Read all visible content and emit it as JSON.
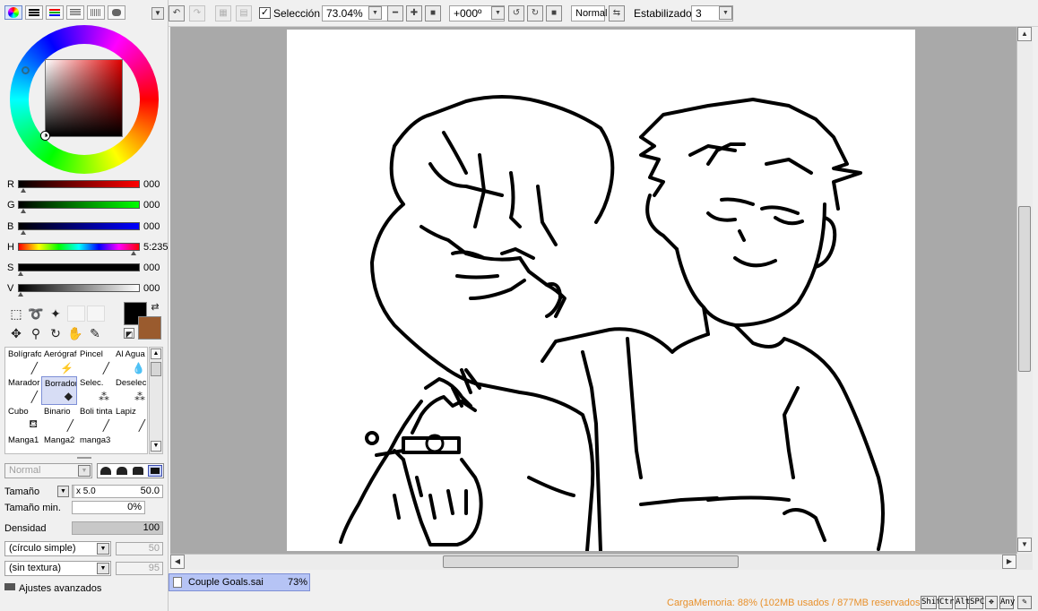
{
  "app": {
    "document_name": "Couple Goals.sai",
    "document_zoom": "73%"
  },
  "color_panel": {
    "sliders": [
      {
        "label": "R",
        "value": "000",
        "color": "#ff0000"
      },
      {
        "label": "G",
        "value": "000",
        "color": "#00ff00"
      },
      {
        "label": "B",
        "value": "000",
        "color": "#0000ff"
      },
      {
        "label": "H",
        "value": "5:235",
        "color": "hue"
      },
      {
        "label": "S",
        "value": "000",
        "color": "#000000"
      },
      {
        "label": "V",
        "value": "000",
        "color": "#ffffff"
      }
    ],
    "foreground_color": "#000000",
    "background_color": "#9a5b2e"
  },
  "brush_tools": [
    {
      "label": "Bolígrafo",
      "icon": "pen-icon"
    },
    {
      "label": "Aerógrafo",
      "icon": "airbrush-icon"
    },
    {
      "label": "Pincel",
      "icon": "brush-icon"
    },
    {
      "label": "Al Agua",
      "icon": "water-icon"
    },
    {
      "label": "Marador",
      "icon": "marker-icon"
    },
    {
      "label": "Borrador",
      "icon": "eraser-icon"
    },
    {
      "label": "Selec.",
      "icon": "select-pen-icon"
    },
    {
      "label": "Deselec.",
      "icon": "deselect-pen-icon"
    },
    {
      "label": "Cubo",
      "icon": "bucket-icon"
    },
    {
      "label": "Binario",
      "icon": "binary-pen-icon"
    },
    {
      "label": "Boli tinta",
      "icon": "ink-pen-icon"
    },
    {
      "label": "Lapiz",
      "icon": "pencil-icon"
    },
    {
      "label": "Manga1",
      "icon": "manga-pen-icon"
    },
    {
      "label": "Manga2",
      "icon": "manga-pen-icon"
    },
    {
      "label": "manga3",
      "icon": "manga-pen-icon"
    }
  ],
  "brush_settings": {
    "blend_mode": "Normal",
    "size_label": "Tamaño",
    "size_multiplier": "x 5.0",
    "size_value": "50.0",
    "min_size_label": "Tamaño min.",
    "min_size_value": "0%",
    "density_label": "Densidad",
    "density_value": "100",
    "shape": "(círculo simple)",
    "shape_value": "50",
    "texture": "(sin textura)",
    "texture_value": "95",
    "advanced_label": "Ajustes avanzados"
  },
  "toolbar": {
    "selection_label": "Selección",
    "selection_checked": true,
    "zoom": "73.04%",
    "rotation": "+000º",
    "view_mode": "Normal",
    "stabilizer_label": "Estabilizador",
    "stabilizer_value": "3"
  },
  "status": {
    "memory_text": "CargaMemoria: 88% (102MB usados / 877MB reservados)",
    "keys": [
      "Shift",
      "Ctrl",
      "Alt",
      "SPC",
      "✥",
      "Any",
      "✎"
    ]
  }
}
